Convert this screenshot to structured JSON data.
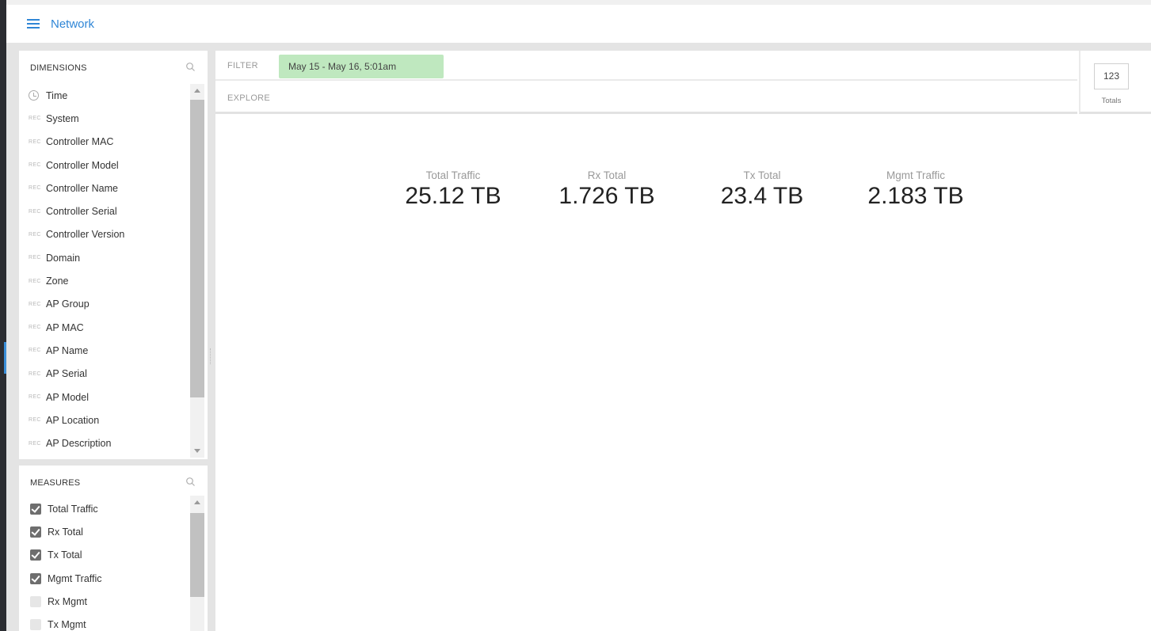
{
  "app": {
    "title": "Network"
  },
  "dimensions": {
    "title": "DIMENSIONS",
    "items": [
      {
        "icon": "clock-icon",
        "label": "Time"
      },
      {
        "icon": "REC",
        "label": "System"
      },
      {
        "icon": "REC",
        "label": "Controller MAC"
      },
      {
        "icon": "REC",
        "label": "Controller Model"
      },
      {
        "icon": "REC",
        "label": "Controller Name"
      },
      {
        "icon": "REC",
        "label": "Controller Serial"
      },
      {
        "icon": "REC",
        "label": "Controller Version"
      },
      {
        "icon": "REC",
        "label": "Domain"
      },
      {
        "icon": "REC",
        "label": "Zone"
      },
      {
        "icon": "REC",
        "label": "AP Group"
      },
      {
        "icon": "REC",
        "label": "AP MAC"
      },
      {
        "icon": "REC",
        "label": "AP Name"
      },
      {
        "icon": "REC",
        "label": "AP Serial"
      },
      {
        "icon": "REC",
        "label": "AP Model"
      },
      {
        "icon": "REC",
        "label": "AP Location"
      },
      {
        "icon": "REC",
        "label": "AP Description"
      }
    ]
  },
  "measures": {
    "title": "MEASURES",
    "items": [
      {
        "label": "Total Traffic",
        "checked": true
      },
      {
        "label": "Rx Total",
        "checked": true
      },
      {
        "label": "Tx Total",
        "checked": true
      },
      {
        "label": "Mgmt Traffic",
        "checked": true
      },
      {
        "label": "Rx Mgmt",
        "checked": false
      },
      {
        "label": "Tx Mgmt",
        "checked": false
      }
    ]
  },
  "filter": {
    "label": "FILTER",
    "chip": "May 15 - May 16, 5:01am"
  },
  "explore": {
    "label": "EXPLORE"
  },
  "viz": {
    "value": "123",
    "label": "Totals"
  },
  "totals": [
    {
      "label": "Total Traffic",
      "value": "25.12 TB"
    },
    {
      "label": "Rx Total",
      "value": "1.726 TB"
    },
    {
      "label": "Tx Total",
      "value": "23.4 TB"
    },
    {
      "label": "Mgmt Traffic",
      "value": "2.183 TB"
    }
  ],
  "colors": {
    "accent": "#2f86d6",
    "filter_chip": "#bfe8bf",
    "checkbox_checked": "#6e6e6e",
    "nav_edge": "#2b2d32"
  }
}
